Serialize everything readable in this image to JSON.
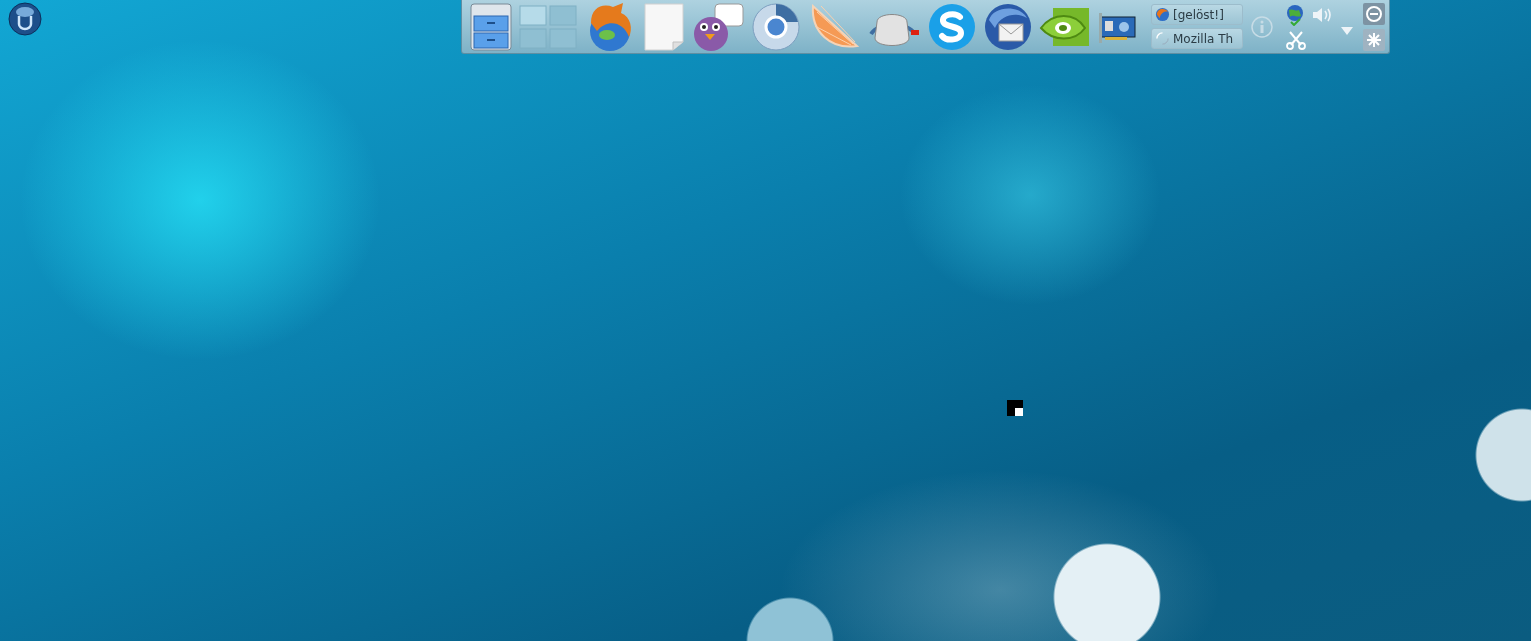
{
  "taskbar": {
    "tasks": [
      {
        "label": "[gelöst!]",
        "kind": "browser"
      },
      {
        "label": "Mozilla Th",
        "kind": "loading"
      }
    ]
  }
}
